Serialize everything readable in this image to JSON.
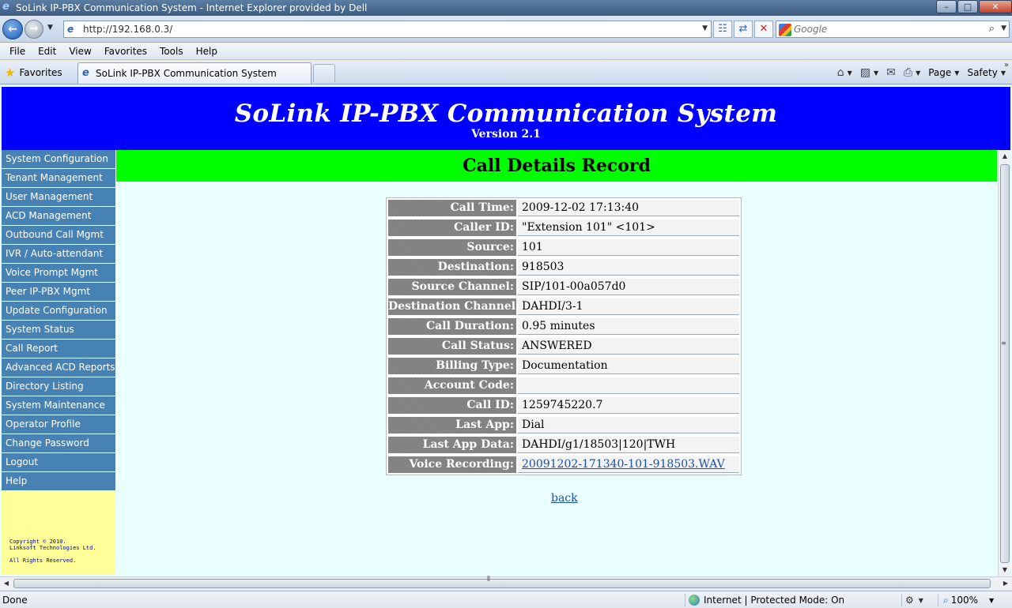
{
  "window": {
    "title": "SoLink IP-PBX Communication System - Internet Explorer provided by Dell",
    "min": "–",
    "max": "□",
    "close": "✕"
  },
  "address": {
    "url": "http://192.168.0.3/",
    "search_placeholder": "Google"
  },
  "menu": [
    "File",
    "Edit",
    "View",
    "Favorites",
    "Tools",
    "Help"
  ],
  "favorites": {
    "label": "Favorites",
    "tab_title": "SoLink IP-PBX Communication System"
  },
  "commands": {
    "page": "Page",
    "safety": "Safety"
  },
  "page": {
    "title": "SoLink IP-PBX Communication System",
    "version": "Version 2.1",
    "heading": "Call Details Record",
    "back_link": "back"
  },
  "sidebar": {
    "items": [
      "System Configuration",
      "Tenant Management",
      "User Management",
      "ACD Management",
      "Outbound Call Mgmt",
      "IVR / Auto-attendant",
      "Voice Prompt Mgmt",
      "Peer IP-PBX Mgmt",
      "Update Configuration",
      "System Status",
      "Call Report",
      "Advanced ACD Reports",
      "Directory Listing",
      "System Maintenance",
      "Operator Profile",
      "Change Password",
      "Logout",
      "Help"
    ],
    "copyright_1": "Copyright © 2010.",
    "copyright_2": "Linksoft Technologies Ltd.",
    "copyright_3": "All Rights Reserved."
  },
  "cdr": {
    "rows": [
      {
        "label": "Call Time:",
        "value": "2009-12-02 17:13:40"
      },
      {
        "label": "Caller ID:",
        "value": "\"Extension 101\" <101>"
      },
      {
        "label": "Source:",
        "value": "101"
      },
      {
        "label": "Destination:",
        "value": "918503"
      },
      {
        "label": "Source Channel:",
        "value": "SIP/101-00a057d0"
      },
      {
        "label": "Destination Channel:",
        "value": "DAHDI/3-1"
      },
      {
        "label": "Call Duration:",
        "value": "0.95 minutes"
      },
      {
        "label": "Call Status:",
        "value": "ANSWERED"
      },
      {
        "label": "Billing Type:",
        "value": "Documentation"
      },
      {
        "label": "Account Code:",
        "value": ""
      },
      {
        "label": "Call ID:",
        "value": "1259745220.7"
      },
      {
        "label": "Last App:",
        "value": "Dial"
      },
      {
        "label": "Last App Data:",
        "value": "DAHDI/g1/18503|120|TWH"
      },
      {
        "label": "Voice Recording:",
        "value": "20091202-171340-101-918503.WAV"
      }
    ]
  },
  "status": {
    "text": "Done",
    "zone": "Internet | Protected Mode: On",
    "zoom": "100%"
  }
}
